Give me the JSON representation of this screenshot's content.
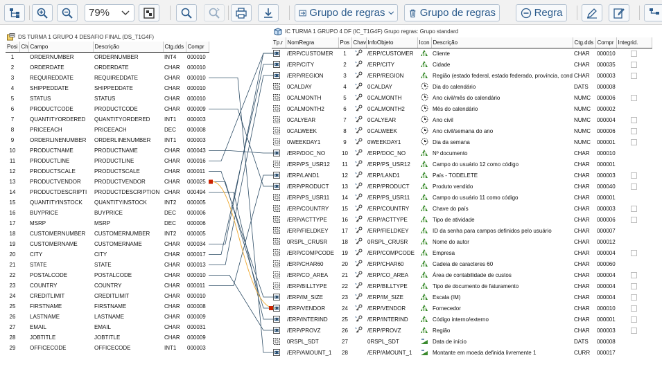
{
  "toolbar": {
    "zoom_value": "79%",
    "group_rules_label": "Grupo de regras",
    "delete_group_label": "Grupo de regras",
    "rule_label": "Regra"
  },
  "left_panel": {
    "title": "DS TURMA 1 GRUPO 4 DESAFIO FINAL (DS_T1G4F)",
    "columns": [
      "Posi",
      "Ch",
      "Campo",
      "Descrição",
      "Ctg.dds",
      "Compr"
    ],
    "rows": [
      {
        "pos": "1",
        "field": "ORDERNUMBER",
        "desc": "ORDERNUMBER",
        "ctg": "INT4",
        "len": "000010"
      },
      {
        "pos": "2",
        "field": "ORDERDATE",
        "desc": "ORDERDATE",
        "ctg": "CHAR",
        "len": "000010"
      },
      {
        "pos": "3",
        "field": "REQUIREDDATE",
        "desc": "REQUIREDDATE",
        "ctg": "CHAR",
        "len": "000010"
      },
      {
        "pos": "4",
        "field": "SHIPPEDDATE",
        "desc": "SHIPPEDDATE",
        "ctg": "CHAR",
        "len": "000010"
      },
      {
        "pos": "5",
        "field": "STATUS",
        "desc": "STATUS",
        "ctg": "CHAR",
        "len": "000010"
      },
      {
        "pos": "6",
        "field": "PRODUCTCODE",
        "desc": "PRODUCTCODE",
        "ctg": "CHAR",
        "len": "000009"
      },
      {
        "pos": "7",
        "field": "QUANTITYORDERED",
        "desc": "QUANTITYORDERED",
        "ctg": "INT1",
        "len": "000003"
      },
      {
        "pos": "8",
        "field": "PRICEEACH",
        "desc": "PRICEEACH",
        "ctg": "DEC",
        "len": "000008"
      },
      {
        "pos": "9",
        "field": "ORDERLINENUMBER",
        "desc": "ORDERLINENUMBER",
        "ctg": "INT1",
        "len": "000003"
      },
      {
        "pos": "10",
        "field": "PRODUCTNAME",
        "desc": "PRODUCTNAME",
        "ctg": "CHAR",
        "len": "000043"
      },
      {
        "pos": "11",
        "field": "PRODUCTLINE",
        "desc": "PRODUCTLINE",
        "ctg": "CHAR",
        "len": "000016"
      },
      {
        "pos": "12",
        "field": "PRODUCTSCALE",
        "desc": "PRODUCTSCALE",
        "ctg": "CHAR",
        "len": "000011"
      },
      {
        "pos": "13",
        "field": "PRODUCTVENDOR",
        "desc": "PRODUCTVENDOR",
        "ctg": "CHAR",
        "len": "000025"
      },
      {
        "pos": "14",
        "field": "PRODUCTDESCRIPTI",
        "desc": "PRODUCTDESCRIPTION",
        "ctg": "CHAR",
        "len": "000494"
      },
      {
        "pos": "15",
        "field": "QUANTITYINSTOCK",
        "desc": "QUANTITYINSTOCK",
        "ctg": "INT2",
        "len": "000005"
      },
      {
        "pos": "16",
        "field": "BUYPRICE",
        "desc": "BUYPRICE",
        "ctg": "DEC",
        "len": "000006"
      },
      {
        "pos": "17",
        "field": "MSRP",
        "desc": "MSRP",
        "ctg": "DEC",
        "len": "000006"
      },
      {
        "pos": "18",
        "field": "CUSTOMERNUMBER",
        "desc": "CUSTOMERNUMBER",
        "ctg": "INT2",
        "len": "000005"
      },
      {
        "pos": "19",
        "field": "CUSTOMERNAME",
        "desc": "CUSTOMERNAME",
        "ctg": "CHAR",
        "len": "000034"
      },
      {
        "pos": "20",
        "field": "CITY",
        "desc": "CITY",
        "ctg": "CHAR",
        "len": "000017"
      },
      {
        "pos": "21",
        "field": "STATE",
        "desc": "STATE",
        "ctg": "CHAR",
        "len": "000013"
      },
      {
        "pos": "22",
        "field": "POSTALCODE",
        "desc": "POSTALCODE",
        "ctg": "CHAR",
        "len": "000010"
      },
      {
        "pos": "23",
        "field": "COUNTRY",
        "desc": "COUNTRY",
        "ctg": "CHAR",
        "len": "000011"
      },
      {
        "pos": "24",
        "field": "CREDITLIMIT",
        "desc": "CREDITLIMIT",
        "ctg": "CHAR",
        "len": "000010"
      },
      {
        "pos": "25",
        "field": "FIRSTNAME",
        "desc": "FIRSTNAME",
        "ctg": "CHAR",
        "len": "000008"
      },
      {
        "pos": "26",
        "field": "LASTNAME",
        "desc": "LASTNAME",
        "ctg": "CHAR",
        "len": "000009"
      },
      {
        "pos": "27",
        "field": "EMAIL",
        "desc": "EMAIL",
        "ctg": "CHAR",
        "len": "000031"
      },
      {
        "pos": "28",
        "field": "JOBTITLE",
        "desc": "JOBTITLE",
        "ctg": "CHAR",
        "len": "000009"
      },
      {
        "pos": "29",
        "field": "OFFICECODE",
        "desc": "OFFICECODE",
        "ctg": "INT1",
        "len": "000003"
      }
    ]
  },
  "right_panel": {
    "title": "IC TURMA 1 GRUPO 4 DF (IC_T1G4F) Grupo regras: Grupo standard",
    "columns": [
      "Tp.r",
      "NomRegra",
      "Pos",
      "Chav",
      "InfoObjeto",
      "Icon",
      "Descrição",
      "Ctg.dds",
      "Compr",
      "Integrid."
    ],
    "rows": [
      {
        "type": "map",
        "rule": "/ERP/CUSTOMER",
        "pos": "1",
        "key": "key",
        "obj": "/ERP/CUSTOMER",
        "icon": "char",
        "desc": "Cliente",
        "ctg": "CHAR",
        "len": "000010",
        "chk": true
      },
      {
        "type": "map",
        "rule": "/ERP/CITY",
        "pos": "2",
        "key": "key",
        "obj": "/ERP/CITY",
        "icon": "char",
        "desc": "Cidade",
        "ctg": "CHAR",
        "len": "000035",
        "chk": true
      },
      {
        "type": "map",
        "rule": "/ERP/REGION",
        "pos": "3",
        "key": "key",
        "obj": "/ERP/REGION",
        "icon": "char",
        "desc": "Região (estado federal, estado federado, província, condad",
        "ctg": "CHAR",
        "len": "000003",
        "chk": true
      },
      {
        "type": "init",
        "rule": "0CALDAY",
        "pos": "4",
        "key": "key",
        "obj": "0CALDAY",
        "icon": "time",
        "desc": "Dia do calendário",
        "ctg": "DATS",
        "len": "000008",
        "chk": false
      },
      {
        "type": "init",
        "rule": "0CALMONTH",
        "pos": "5",
        "key": "key",
        "obj": "0CALMONTH",
        "icon": "time",
        "desc": "Ano civil/mês do calendário",
        "ctg": "NUMC",
        "len": "000006",
        "chk": true
      },
      {
        "type": "init",
        "rule": "0CALMONTH2",
        "pos": "6",
        "key": "key",
        "obj": "0CALMONTH2",
        "icon": "time",
        "desc": "Mês do calendário",
        "ctg": "NUMC",
        "len": "000002",
        "chk": false
      },
      {
        "type": "init",
        "rule": "0CALYEAR",
        "pos": "7",
        "key": "key",
        "obj": "0CALYEAR",
        "icon": "time",
        "desc": "Ano civil",
        "ctg": "NUMC",
        "len": "000004",
        "chk": true
      },
      {
        "type": "init",
        "rule": "0CALWEEK",
        "pos": "8",
        "key": "key",
        "obj": "0CALWEEK",
        "icon": "time",
        "desc": "Ano civil/semana do ano",
        "ctg": "NUMC",
        "len": "000006",
        "chk": true
      },
      {
        "type": "init",
        "rule": "0WEEKDAY1",
        "pos": "9",
        "key": "key",
        "obj": "0WEEKDAY1",
        "icon": "time",
        "desc": "Dia da semana",
        "ctg": "NUMC",
        "len": "000001",
        "chk": true
      },
      {
        "type": "map",
        "rule": "/ERP/DOC_NO",
        "pos": "10",
        "key": "key",
        "obj": "/ERP/DOC_NO",
        "icon": "char",
        "desc": "Nº documento",
        "ctg": "CHAR",
        "len": "000010",
        "chk": false
      },
      {
        "type": "init",
        "rule": "/ERP/PS_USR12",
        "pos": "11",
        "key": "key",
        "obj": "/ERP/PS_USR12",
        "icon": "char",
        "desc": "Campo do usuário 12 como código",
        "ctg": "CHAR",
        "len": "000001",
        "chk": false
      },
      {
        "type": "map",
        "rule": "/ERP/LAND1",
        "pos": "12",
        "key": "key",
        "obj": "/ERP/LAND1",
        "icon": "char",
        "desc": "País - TODELETE",
        "ctg": "CHAR",
        "len": "000003",
        "chk": true
      },
      {
        "type": "map",
        "rule": "/ERP/PRODUCT",
        "pos": "13",
        "key": "key",
        "obj": "/ERP/PRODUCT",
        "icon": "char",
        "desc": "Produto vendido",
        "ctg": "CHAR",
        "len": "000040",
        "chk": true
      },
      {
        "type": "init",
        "rule": "/ERP/PS_USR11",
        "pos": "14",
        "key": "key",
        "obj": "/ERP/PS_USR11",
        "icon": "char",
        "desc": "Campo do usuário 11 como código",
        "ctg": "CHAR",
        "len": "000001",
        "chk": false
      },
      {
        "type": "init",
        "rule": "/ERP/COUNTRY",
        "pos": "15",
        "key": "key",
        "obj": "/ERP/COUNTRY",
        "icon": "char",
        "desc": "Chave do país",
        "ctg": "CHAR",
        "len": "000003",
        "chk": true
      },
      {
        "type": "init",
        "rule": "/ERP/ACTTYPE",
        "pos": "16",
        "key": "key",
        "obj": "/ERP/ACTTYPE",
        "icon": "char",
        "desc": "Tipo de atividade",
        "ctg": "CHAR",
        "len": "000006",
        "chk": true
      },
      {
        "type": "init",
        "rule": "/ERP/FIELDKEY",
        "pos": "17",
        "key": "key",
        "obj": "/ERP/FIELDKEY",
        "icon": "char",
        "desc": "ID da senha para campos definidos pelo usuário",
        "ctg": "CHAR",
        "len": "000007",
        "chk": false
      },
      {
        "type": "init",
        "rule": "0RSPL_CRUSR",
        "pos": "18",
        "key": "key",
        "obj": "0RSPL_CRUSR",
        "icon": "char",
        "desc": "Nome do autor",
        "ctg": "CHAR",
        "len": "000012",
        "chk": false
      },
      {
        "type": "init",
        "rule": "/ERP/COMPCODE",
        "pos": "19",
        "key": "key",
        "obj": "/ERP/COMPCODE",
        "icon": "char",
        "desc": "Empresa",
        "ctg": "CHAR",
        "len": "000004",
        "chk": true
      },
      {
        "type": "init",
        "rule": "/ERP/CHAR60",
        "pos": "20",
        "key": "key",
        "obj": "/ERP/CHAR60",
        "icon": "char",
        "desc": "Cadeia de caracteres 60",
        "ctg": "CHAR",
        "len": "000060",
        "chk": false
      },
      {
        "type": "init",
        "rule": "/ERP/CO_AREA",
        "pos": "21",
        "key": "key",
        "obj": "/ERP/CO_AREA",
        "icon": "char",
        "desc": "Área de contabilidade de custos",
        "ctg": "CHAR",
        "len": "000004",
        "chk": true
      },
      {
        "type": "init",
        "rule": "/ERP/BILLTYPE",
        "pos": "22",
        "key": "key",
        "obj": "/ERP/BILLTYPE",
        "icon": "char",
        "desc": "Tipo de documento de faturamento",
        "ctg": "CHAR",
        "len": "000004",
        "chk": true
      },
      {
        "type": "map",
        "rule": "/ERP/IM_SIZE",
        "pos": "23",
        "key": "key",
        "obj": "/ERP/IM_SIZE",
        "icon": "char",
        "desc": "Escala (IM)",
        "ctg": "CHAR",
        "len": "000004",
        "chk": true
      },
      {
        "type": "map",
        "rule": "/ERP/VENDOR",
        "pos": "24",
        "key": "key",
        "obj": "/ERP/VENDOR",
        "icon": "char",
        "desc": "Fornecedor",
        "ctg": "CHAR",
        "len": "000010",
        "chk": true,
        "flag": true
      },
      {
        "type": "map",
        "rule": "/ERP/INTERIND",
        "pos": "25",
        "key": "key",
        "obj": "/ERP/INTERIND",
        "icon": "char",
        "desc": "Código interno/externo",
        "ctg": "CHAR",
        "len": "000001",
        "chk": true
      },
      {
        "type": "map",
        "rule": "/ERP/PROVZ",
        "pos": "26",
        "key": "key",
        "obj": "/ERP/PROVZ",
        "icon": "char",
        "desc": "Região",
        "ctg": "CHAR",
        "len": "000003",
        "chk": true
      },
      {
        "type": "init",
        "rule": "0RSPL_SDT",
        "pos": "27",
        "key": "",
        "obj": "0RSPL_SDT",
        "icon": "kf",
        "desc": "Data de início",
        "ctg": "DATS",
        "len": "000008",
        "chk": false
      },
      {
        "type": "map",
        "rule": "/ERP/AMOUNT_1",
        "pos": "28",
        "key": "",
        "obj": "/ERP/AMOUNT_1",
        "icon": "kf",
        "desc": "Montante em moeda definida livremente 1",
        "ctg": "CURR",
        "len": "000017",
        "chk": false
      }
    ]
  },
  "colors": {
    "toolbar_bg": "#f2f2f2",
    "accent": "#2b5b8c",
    "link_line": "#2e4d66",
    "highlight_line": "#f0b040",
    "marker_red": "#cc2200"
  },
  "mappings": [
    [
      20,
      2
    ],
    [
      21,
      3
    ],
    [
      10,
      10
    ],
    [
      23,
      12
    ],
    [
      6,
      13
    ],
    [
      12,
      23
    ],
    [
      13,
      24
    ],
    [
      22,
      26
    ],
    [
      14,
      25
    ],
    [
      3,
      28
    ],
    [
      11,
      1
    ],
    [
      19,
      1
    ]
  ]
}
